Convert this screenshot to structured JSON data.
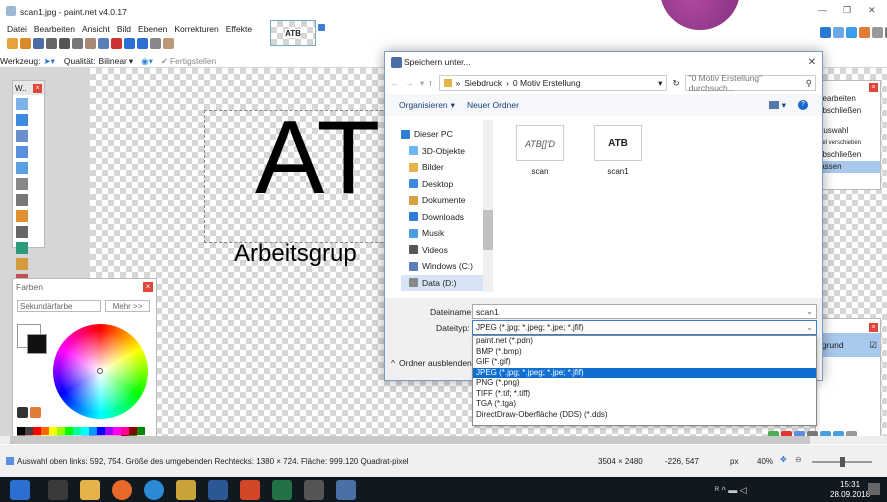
{
  "window": {
    "title": "scan1.jpg - paint.net v4.0.17",
    "min": "—",
    "max": "❐",
    "close": "✕"
  },
  "menu": [
    "Datei",
    "Bearbeiten",
    "Ansicht",
    "Bild",
    "Ebenen",
    "Korrekturen",
    "Effekte"
  ],
  "thumb_label": "ATB",
  "toolbar2": {
    "tool_label": "Werkzeug:",
    "quality_label": "Qualität:",
    "quality_value": "Bilinear",
    "finish": "Fertigstellen"
  },
  "canvas": {
    "big_text": "AT",
    "sub_text": "Arbeitsgrup"
  },
  "tools_panel": {
    "title": "W..",
    "close": "×"
  },
  "colors_panel": {
    "title": "Farben",
    "close": "×",
    "select": "Sekundärfarbe",
    "more": "Mehr >>"
  },
  "history_panel": {
    "items": [
      "bearbeiten",
      "abschließen",
      "Auswahl",
      "ixel verschieben",
      "abschließen",
      "fassen"
    ]
  },
  "layers_panel": {
    "close": "×",
    "item": "rgrund",
    "checkbox": "☑"
  },
  "dialog": {
    "title": "Speichern unter...",
    "close": "✕",
    "path_root": "»",
    "path_a": "Siebdruck",
    "path_sep": "›",
    "path_b": "0 Motiv Erstellung",
    "search_placeholder": "\"0 Motiv Erstellung\" durchsuch...",
    "organize": "Organisieren",
    "new_folder": "Neuer Ordner",
    "nav": [
      "Dieser PC",
      "3D-Objekte",
      "Bilder",
      "Desktop",
      "Dokumente",
      "Downloads",
      "Musik",
      "Videos",
      "Windows (C:)",
      "Data (D:)"
    ],
    "files": [
      {
        "name": "scan",
        "thumb": "ATB[]'D"
      },
      {
        "name": "scan1",
        "thumb": "ATB"
      }
    ],
    "filename_label": "Dateiname:",
    "filename_value": "scan1",
    "filetype_label": "Dateityp:",
    "filetype_value": "JPEG (*.jpg; *.jpeg; *.jpe; *.jfif)",
    "hide_folders": "Ordner ausblenden",
    "types": [
      "paint.net (*.pdn)",
      "BMP (*.bmp)",
      "GIF (*.gif)",
      "JPEG (*.jpg; *.jpeg; *.jpe; *.jfif)",
      "PNG (*.png)",
      "TIFF (*.tif; *.tiff)",
      "TGA (*.tga)",
      "DirectDraw-Oberfläche (DDS) (*.dds)"
    ],
    "selected_type_index": 3
  },
  "status": {
    "left": "Auswahl oben links: 592, 754. Größe des umgebenden Rechtecks: 1380 × 724. Fläche: 999.120 Quadrat-pixel",
    "size": "3504 × 2480",
    "pos": "-226, 547",
    "unit": "px",
    "zoom": "40%"
  },
  "taskbar": {
    "time": "15:31",
    "date": "28.09.2018"
  }
}
